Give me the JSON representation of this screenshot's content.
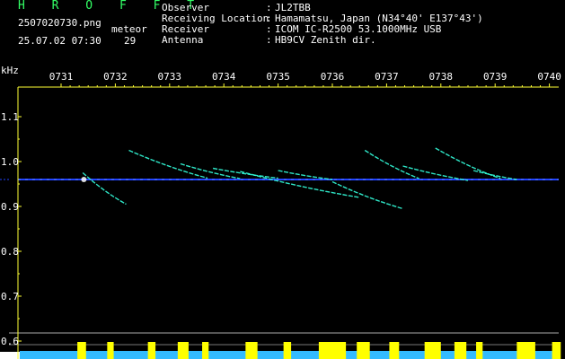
{
  "header": {
    "program": "H R O F F T",
    "filename": "2507020730.png",
    "datetime": "25.07.02 07:30",
    "meteor_label": "meteor",
    "meteor_count": "29"
  },
  "station": [
    {
      "label": "Observer",
      "value": "JL2TBB"
    },
    {
      "label": "Receiving Location",
      "value": "Hamamatsu, Japan (N34°40' E137°43')"
    },
    {
      "label": "Receiver",
      "value": "ICOM IC-R2500 53.1000MHz USB"
    },
    {
      "label": "Antenna",
      "value": "HB9CV Zenith dir."
    }
  ],
  "colors": {
    "program": "#33ff66",
    "text": "#ffffff",
    "axis": "#ffff33",
    "carrier": "#2244ff",
    "echo": "#33ffdd",
    "level": "#ffff00",
    "noise_floor": "#33bbff"
  },
  "chart_data": {
    "type": "heatmap",
    "ylabel": "kHz",
    "time_ticks": [
      "0731",
      "0732",
      "0733",
      "0734",
      "0735",
      "0736",
      "0737",
      "0738",
      "0739",
      "0740"
    ],
    "freq_ticks": [
      "1.1",
      "1.0",
      "0.9",
      "0.8",
      "0.7",
      "0.6"
    ],
    "ylim": [
      0.6,
      1.15
    ],
    "carrier_khz": 0.96,
    "echoes": [
      {
        "start": 0.4,
        "end": 1.2,
        "f_start": 0.975,
        "f_end": 0.905
      },
      {
        "start": 1.25,
        "end": 2.7,
        "f_start": 1.025,
        "f_end": 0.963
      },
      {
        "start": 2.2,
        "end": 3.3,
        "f_start": 0.995,
        "f_end": 0.962
      },
      {
        "start": 2.8,
        "end": 4.0,
        "f_start": 0.985,
        "f_end": 0.963
      },
      {
        "start": 3.3,
        "end": 5.5,
        "f_start": 0.978,
        "f_end": 0.92
      },
      {
        "start": 4.0,
        "end": 5.0,
        "f_start": 0.98,
        "f_end": 0.96
      },
      {
        "start": 5.0,
        "end": 6.3,
        "f_start": 0.955,
        "f_end": 0.895
      },
      {
        "start": 5.6,
        "end": 6.6,
        "f_start": 1.025,
        "f_end": 0.962
      },
      {
        "start": 6.3,
        "end": 7.5,
        "f_start": 0.99,
        "f_end": 0.958
      },
      {
        "start": 6.9,
        "end": 8.1,
        "f_start": 1.03,
        "f_end": 0.962
      },
      {
        "start": 7.6,
        "end": 8.4,
        "f_start": 0.98,
        "f_end": 0.96
      }
    ],
    "level_bursts": [
      {
        "t": 0.3,
        "w": 0.16
      },
      {
        "t": 0.85,
        "w": 0.12
      },
      {
        "t": 1.6,
        "w": 0.14
      },
      {
        "t": 2.15,
        "w": 0.2
      },
      {
        "t": 2.6,
        "w": 0.12
      },
      {
        "t": 3.4,
        "w": 0.22
      },
      {
        "t": 4.1,
        "w": 0.14
      },
      {
        "t": 4.75,
        "w": 0.5
      },
      {
        "t": 5.45,
        "w": 0.24
      },
      {
        "t": 6.05,
        "w": 0.18
      },
      {
        "t": 6.7,
        "w": 0.3
      },
      {
        "t": 7.25,
        "w": 0.22
      },
      {
        "t": 7.65,
        "w": 0.12
      },
      {
        "t": 8.4,
        "w": 0.34
      },
      {
        "t": 9.05,
        "w": 0.16
      }
    ]
  }
}
